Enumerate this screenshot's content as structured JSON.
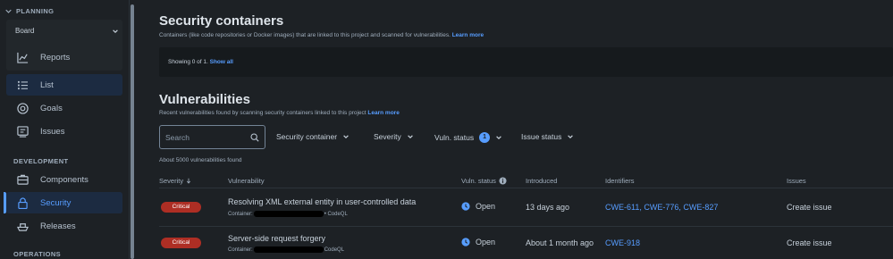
{
  "sidebar": {
    "planning_label": "PLANNING",
    "board_label": "Board",
    "items_planning": [
      {
        "label": "Reports",
        "icon": "chart-line-icon"
      },
      {
        "label": "List",
        "icon": "list-icon"
      },
      {
        "label": "Goals",
        "icon": "target-icon"
      },
      {
        "label": "Issues",
        "icon": "issues-icon"
      }
    ],
    "development_label": "DEVELOPMENT",
    "items_development": [
      {
        "label": "Components",
        "icon": "components-icon"
      },
      {
        "label": "Security",
        "icon": "lock-icon"
      },
      {
        "label": "Releases",
        "icon": "ship-icon"
      }
    ],
    "operations_label": "OPERATIONS"
  },
  "containers": {
    "title": "Security containers",
    "description": "Containers (like code repositories or Docker images) that are linked to this project and scanned for vulnerabilities.",
    "learn_more": "Learn more",
    "showing": "Showing 0 of 1.",
    "show_all": "Show all"
  },
  "vulnerabilities": {
    "title": "Vulnerabilities",
    "description": "Recent vulnerabilities found by scanning security containers linked to this project",
    "learn_more": "Learn more",
    "search_placeholder": "Search",
    "filters": {
      "container": "Security container",
      "severity": "Severity",
      "vuln_status": "Vuln. status",
      "vuln_status_count": "1",
      "issue_status": "Issue status"
    },
    "count_text": "About 5000 vulnerabilities found",
    "columns": {
      "severity": "Severity",
      "vulnerability": "Vulnerability",
      "vuln_status": "Vuln. status",
      "introduced": "Introduced",
      "identifiers": "Identifiers",
      "issues": "Issues"
    },
    "rows": [
      {
        "severity": "Critical",
        "title": "Resolving XML external entity in user-controlled data",
        "container_prefix": "Container:",
        "source": "• CodeQL",
        "status": "Open",
        "introduced": "13 days ago",
        "identifiers": "CWE-611, CWE-776, CWE-827",
        "issue": "Create issue"
      },
      {
        "severity": "Critical",
        "title": "Server-side request forgery",
        "container_prefix": "Container:",
        "source": "CodeQL",
        "status": "Open",
        "introduced": "About 1 month ago",
        "identifiers": "CWE-918",
        "issue": "Create issue"
      }
    ]
  },
  "colors": {
    "background": "#1d2125",
    "accent": "#579dff",
    "critical": "#ae2e24"
  }
}
